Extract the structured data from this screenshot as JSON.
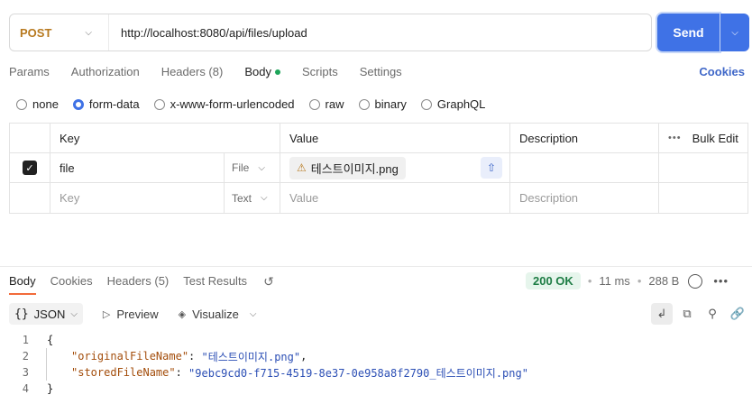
{
  "request": {
    "method": "POST",
    "url": "http://localhost:8080/api/files/upload",
    "send_label": "Send"
  },
  "request_tabs": [
    {
      "label": "Params"
    },
    {
      "label": "Authorization"
    },
    {
      "label": "Headers (8)"
    },
    {
      "label": "Body"
    },
    {
      "label": "Scripts"
    },
    {
      "label": "Settings"
    }
  ],
  "cookies_label": "Cookies",
  "body_types": [
    {
      "label": "none",
      "selected": false
    },
    {
      "label": "form-data",
      "selected": true
    },
    {
      "label": "x-www-form-urlencoded",
      "selected": false
    },
    {
      "label": "raw",
      "selected": false
    },
    {
      "label": "binary",
      "selected": false
    },
    {
      "label": "GraphQL",
      "selected": false
    }
  ],
  "form_table": {
    "headers": {
      "key": "Key",
      "value": "Value",
      "description": "Description",
      "bulk_edit": "Bulk Edit"
    },
    "row": {
      "key": "file",
      "type": "File",
      "file_name": "테스트이미지.png"
    },
    "empty_row": {
      "key_placeholder": "Key",
      "type": "Text",
      "value_placeholder": "Value",
      "description_placeholder": "Description"
    }
  },
  "response": {
    "tabs": [
      {
        "label": "Body"
      },
      {
        "label": "Cookies"
      },
      {
        "label": "Headers (5)"
      },
      {
        "label": "Test Results"
      }
    ],
    "status": "200 OK",
    "time": "11 ms",
    "size": "288 B",
    "format": "JSON",
    "preview_label": "Preview",
    "visualize_label": "Visualize",
    "lines": [
      {
        "num": "1",
        "text": "{"
      },
      {
        "num": "2",
        "key": "\"originalFileName\"",
        "value": "\"테스트이미지.png\"",
        "trail": ","
      },
      {
        "num": "3",
        "key": "\"storedFileName\"",
        "value": "\"9ebc9cd0-f715-4519-8e37-0e958a8f2790_테스트이미지.png\"",
        "trail": ""
      },
      {
        "num": "4",
        "text": "}"
      }
    ]
  },
  "colors": {
    "accent": "#3f72e6",
    "method": "#b7791f",
    "status_ok": "#1e7d45",
    "active_tab_underline": "#f26b3a"
  }
}
